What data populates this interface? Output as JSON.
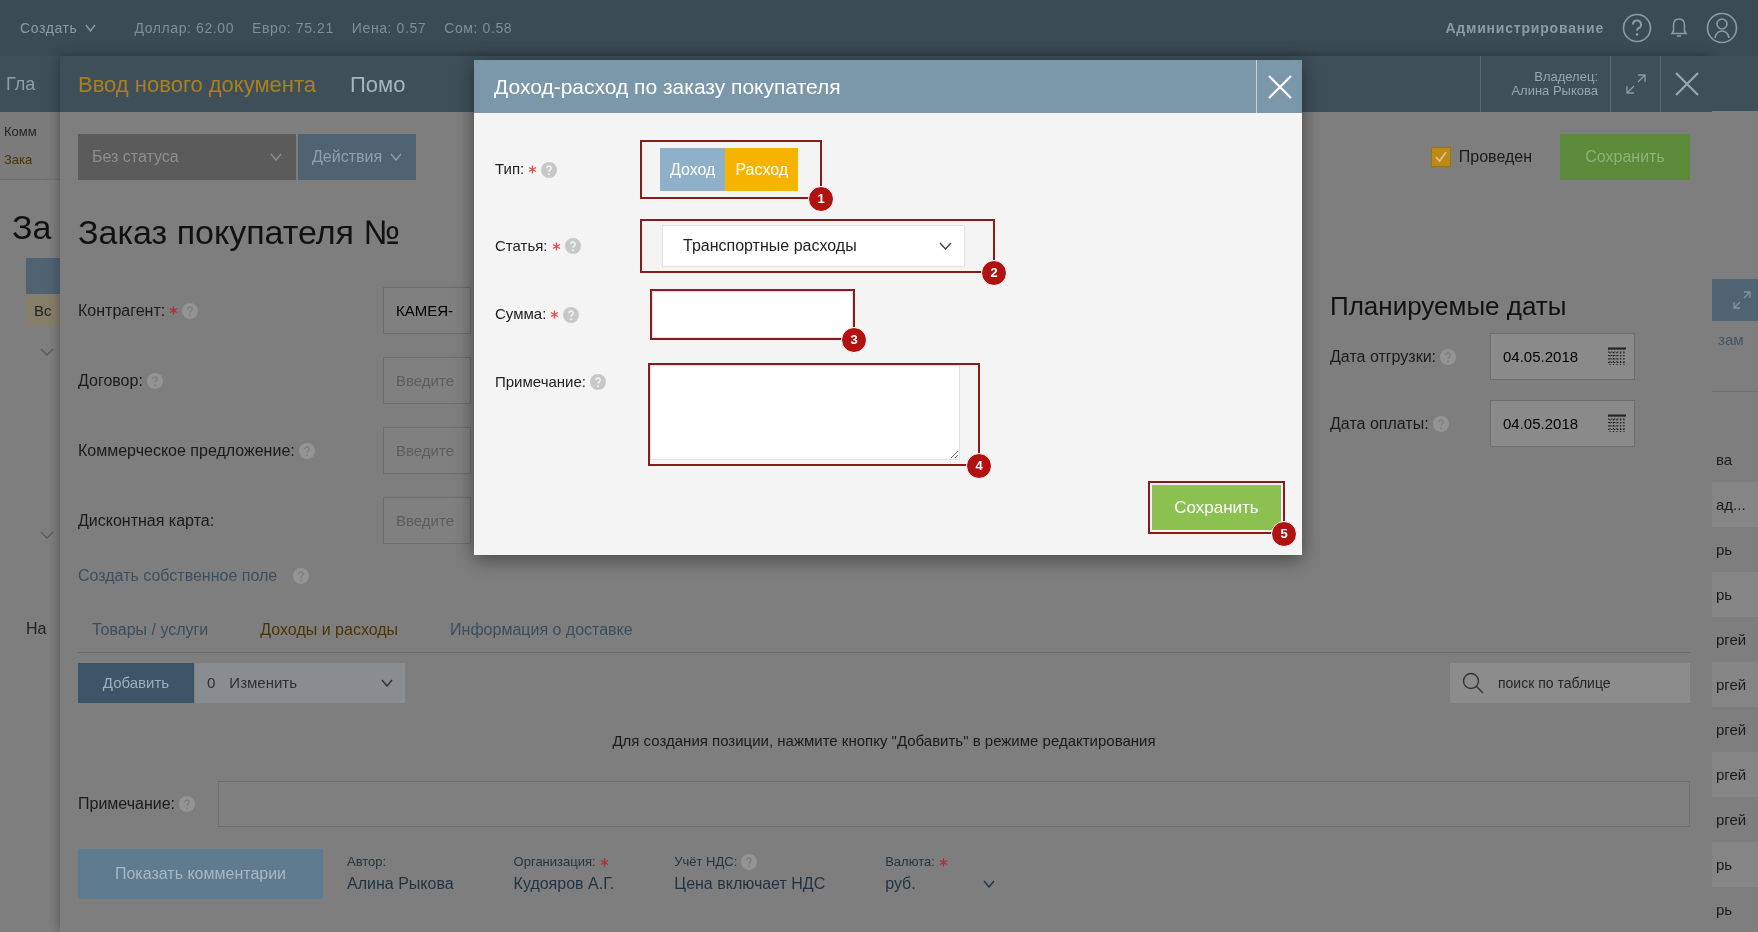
{
  "top_bar": {
    "create_menu": "Создать",
    "rates": [
      "Доллар: 62.00",
      "Евро: 75.21",
      "Иена: 0.57",
      "Сом: 0.58"
    ],
    "admin_link": "Администрирование"
  },
  "background": {
    "left": {
      "nav_item": "Гла",
      "breadcrumb": "Комм",
      "breadcrumb_current": "Зака",
      "title": "За",
      "filter_tag": "Вс",
      "heading": "На"
    },
    "right": {
      "link": "зам",
      "rows": [
        "ва",
        "ад...",
        "рь",
        "рь",
        "ргей",
        "ргей",
        "ргей",
        "ргей",
        "ргей",
        "рь",
        "рь"
      ]
    }
  },
  "panel": {
    "tabs": [
      {
        "label": "Ввод нового документа",
        "selected": true
      },
      {
        "label": "Помо",
        "selected": false
      }
    ],
    "owner_label": "Владелец:",
    "owner_name": "Алина Рыкова",
    "status_select": "Без статуса",
    "actions_menu": "Действия",
    "posted": {
      "label": "Проведен",
      "checked": true
    },
    "save_button": "Сохранить",
    "title": "Заказ покупателя №",
    "fields": [
      {
        "label": "Контрагент:",
        "required": true,
        "help": true,
        "value": "КАМЕЯ-"
      },
      {
        "label": "Договор:",
        "required": false,
        "help": true,
        "placeholder": "Введите"
      },
      {
        "label": "Коммерческое предложение:",
        "required": false,
        "help": true,
        "placeholder": "Введите"
      },
      {
        "label": "Дисконтная карта:",
        "required": false,
        "help": false,
        "placeholder": "Введите"
      }
    ],
    "custom_field_link": "Создать собственное поле",
    "planned_dates": {
      "title": "Планируемые даты",
      "fields": [
        {
          "label": "Дата отгрузки:",
          "value": "04.05.2018"
        },
        {
          "label": "Дата оплаты:",
          "value": "04.05.2018"
        }
      ]
    },
    "section_tabs": [
      {
        "label": "Товары / услуги",
        "selected": false
      },
      {
        "label": "Доходы и расходы",
        "selected": true
      },
      {
        "label": "Информация о доставке",
        "selected": false
      }
    ],
    "table_toolbar": {
      "add_button": "Добавить",
      "edit_count": "0",
      "edit_menu": "Изменить",
      "search_placeholder": "поиск по таблице"
    },
    "empty_message": "Для создания позиции, нажмите кнопку \"Добавить\" в режиме редактирования",
    "note": {
      "label": "Примечание:",
      "help": true
    },
    "footer": {
      "comments_button": "Показать комментарии",
      "meta": [
        {
          "kind": "text",
          "label": "Автор:",
          "required": false,
          "help": false,
          "value": "Алина Рыкова"
        },
        {
          "kind": "text",
          "label": "Организация:",
          "required": true,
          "help": false,
          "value": "Кудояров А.Г."
        },
        {
          "kind": "text",
          "label": "Учёт НДС:",
          "required": false,
          "help": true,
          "value": "Цена включает НДС"
        },
        {
          "kind": "select",
          "label": "Валюта:",
          "required": true,
          "help": false,
          "value": "руб."
        }
      ]
    }
  },
  "modal": {
    "title": "Доход-расход по заказу покупателя",
    "rows": [
      {
        "kind": "toggle",
        "label": "Тип:",
        "required": true,
        "help": true,
        "callout": "1",
        "options": [
          {
            "label": "Доход",
            "selected": false
          },
          {
            "label": "Расход",
            "selected": true
          }
        ]
      },
      {
        "kind": "select",
        "label": "Статья:",
        "required": true,
        "help": true,
        "callout": "2",
        "value": "Транспортные расходы"
      },
      {
        "kind": "input",
        "label": "Сумма:",
        "required": true,
        "help": true,
        "callout": "3"
      },
      {
        "kind": "textarea",
        "label": "Примечание:",
        "required": false,
        "help": true,
        "callout": "4"
      }
    ],
    "save_button": "Сохранить",
    "save_callout": "5"
  }
}
